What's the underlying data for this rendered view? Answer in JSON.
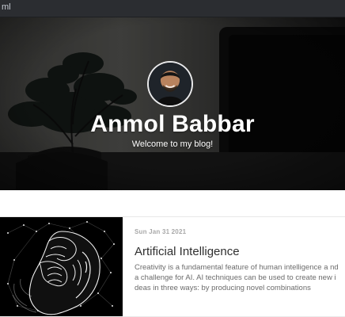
{
  "browser": {
    "partial_url_text": "ml"
  },
  "hero": {
    "name": "Anmol Babbar",
    "tagline": "Welcome to my blog!"
  },
  "post": {
    "date": "Sun Jan 31 2021",
    "title": "Artificial Intelligence",
    "excerpt": "Creativity is a fundamental feature of human intelligence a nd a challenge for AI. AI techniques can be used to create new ideas in three ways: by producing novel combinations"
  },
  "icons": {
    "avatar": "person-avatar",
    "hero_image": "plant-and-monitor-photo",
    "post_image": "brain-neural-network-photo"
  },
  "colors": {
    "hero_text": "#ffffff",
    "post_title": "#2f2f2f",
    "post_text": "#6b6b6b",
    "post_date": "#a8a8a8"
  }
}
